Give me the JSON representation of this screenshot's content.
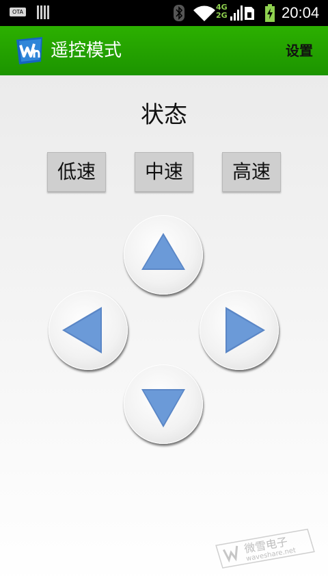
{
  "status_bar": {
    "ota_label": "OTA",
    "network_label_top": "4G",
    "network_label_bottom": "2G",
    "time": "20:04",
    "icons": [
      "ota-icon",
      "notification-bars-icon",
      "bluetooth-icon",
      "wifi-icon",
      "signal-icon",
      "sim-icon",
      "battery-charging-icon"
    ]
  },
  "action_bar": {
    "title": "遥控模式",
    "settings_label": "设置",
    "logo_icon": "waveshare-logo-icon",
    "color": "#23a300"
  },
  "main": {
    "status_text": "状态",
    "speed_buttons": [
      {
        "label": "低速"
      },
      {
        "label": "中速"
      },
      {
        "label": "高速"
      }
    ],
    "direction_buttons": [
      {
        "icon": "arrow-up-icon"
      },
      {
        "icon": "arrow-left-icon"
      },
      {
        "icon": "arrow-right-icon"
      },
      {
        "icon": "arrow-down-icon"
      }
    ],
    "arrow_color": "#6b9ad8"
  },
  "watermark": {
    "text_cn": "微雪电子",
    "text_url": "waveshare.net"
  }
}
